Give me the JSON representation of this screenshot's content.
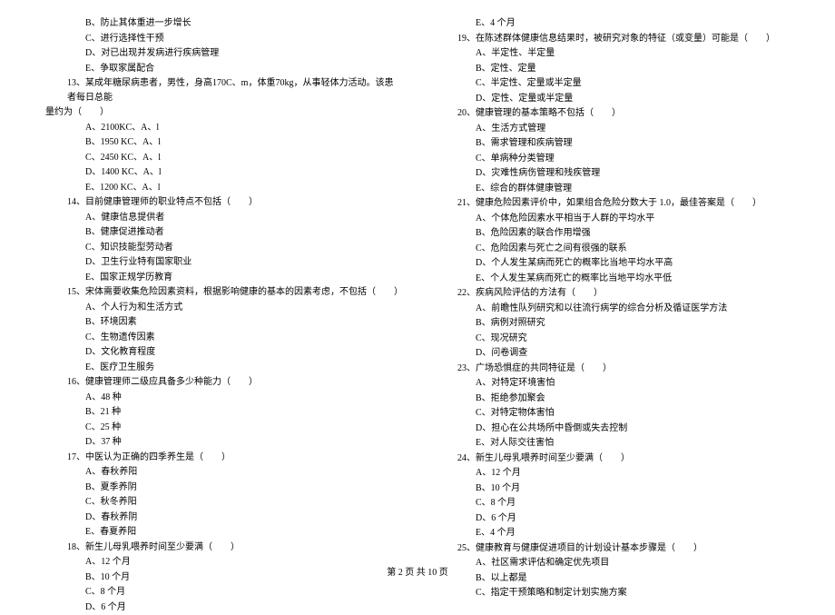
{
  "leftColumn": {
    "preOpts": [
      "B、防止其体重进一步增长",
      "C、进行选择性干预",
      "D、对已出现并发病进行疾病管理",
      "E、争取家属配合"
    ],
    "q13": {
      "stem1": "13、某成年糖尿病患者，男性，身高170C、m，体重70kg，从事轻体力活动。该患者每日总能",
      "stem2": "量约为（　　）",
      "opts": [
        "A、2100KC、A、l",
        "B、1950 KC、A、l",
        "C、2450 KC、A、l",
        "D、1400 KC、A、l",
        "E、1200 KC、A、l"
      ]
    },
    "q14": {
      "stem": "14、目前健康管理师的职业特点不包括（　　）",
      "opts": [
        "A、健康信息提供者",
        "B、健康促进推动者",
        "C、知识技能型劳动者",
        "D、卫生行业特有国家职业",
        "E、国家正规学历教育"
      ]
    },
    "q15": {
      "stem": "15、宋体需要收集危险因素资料，根据影响健康的基本的因素考虑，不包括（　　）",
      "opts": [
        "A、个人行为和生活方式",
        "B、环境因素",
        "C、生物遗传因素",
        "D、文化教育程度",
        "E、医疗卫生服务"
      ]
    },
    "q16": {
      "stem": "16、健康管理师二级应具备多少种能力（　　）",
      "opts": [
        "A、48 种",
        "B、21 种",
        "C、25 种",
        "D、37 种"
      ]
    },
    "q17": {
      "stem": "17、中医认为正确的四季养生是（　　）",
      "opts": [
        "A、春秋养阳",
        "B、夏季养阴",
        "C、秋冬养阳",
        "D、春秋养阴",
        "E、春夏养阳"
      ]
    },
    "q18": {
      "stem": "18、新生儿母乳喂养时间至少要满（　　）",
      "opts": [
        "A、12 个月",
        "B、10 个月",
        "C、8 个月",
        "D、6 个月"
      ]
    }
  },
  "rightColumn": {
    "preOpts": [
      "E、4 个月"
    ],
    "q19": {
      "stem": "19、在陈述群体健康信息结果时，被研究对象的特征（或变量）可能是（　　）",
      "opts": [
        "A、半定性、半定量",
        "B、定性、定量",
        "C、半定性、定量或半定量",
        "D、定性、定量或半定量"
      ]
    },
    "q20": {
      "stem": "20、健康管理的基本策略不包括（　　）",
      "opts": [
        "A、生活方式管理",
        "B、需求管理和疾病管理",
        "C、单病种分类管理",
        "D、灾难性病伤管理和残疾管理",
        "E、综合的群体健康管理"
      ]
    },
    "q21": {
      "stem": "21、健康危险因素评价中，如果组合危险分数大于 1.0，最佳答案是（　　）",
      "opts": [
        "A、个体危险因素水平相当于人群的平均水平",
        "B、危险因素的联合作用增强",
        "C、危险因素与死亡之间有很强的联系",
        "D、个人发生某病而死亡的概率比当地平均水平高",
        "E、个人发生某病而死亡的概率比当地平均水平低"
      ]
    },
    "q22": {
      "stem": "22、疾病风险评估的方法有（　　）",
      "opts": [
        "A、前瞻性队列研究和以往流行病学的综合分析及循证医学方法",
        "B、病例对照研究",
        "C、现况研究",
        "D、问卷调查"
      ]
    },
    "q23": {
      "stem": "23、广场恐惧症的共同特征是（　　）",
      "opts": [
        "A、对特定环境害怕",
        "B、拒绝参加聚会",
        "C、对特定物体害怕",
        "D、担心在公共场所中昏倒或失去控制",
        "E、对人际交往害怕"
      ]
    },
    "q24": {
      "stem": "24、新生儿母乳喂养时间至少要满（　　）",
      "opts": [
        "A、12 个月",
        "B、10 个月",
        "C、8 个月",
        "D、6 个月",
        "E、4 个月"
      ]
    },
    "q25": {
      "stem": "25、健康教育与健康促进项目的计划设计基本步骤是（　　）",
      "opts": [
        "A、社区需求评估和确定优先项目",
        "B、以上都是",
        "C、指定干预策略和制定计划实施方案"
      ]
    }
  },
  "footer": "第 2 页 共 10 页"
}
